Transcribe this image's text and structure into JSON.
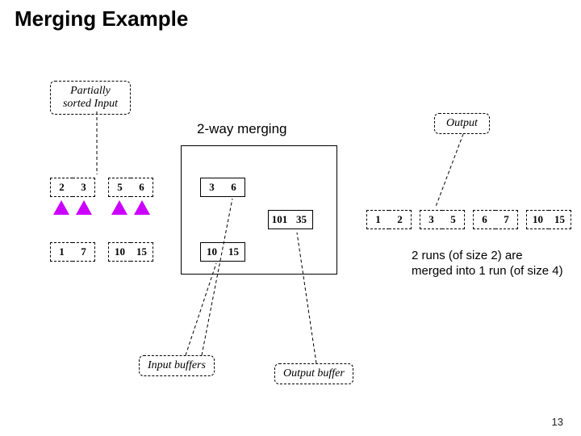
{
  "title": "Merging Example",
  "callouts": {
    "input": "Partially\nsorted Input",
    "output": "Output",
    "input_buffers": "Input buffers",
    "output_buffer": "Output buffer"
  },
  "merge_label": "2-way merging",
  "rows": {
    "top_left": [
      "2",
      "3",
      "5",
      "6"
    ],
    "bot_left": [
      "1",
      "7",
      "10",
      "15"
    ],
    "mid_buf_top": [
      "3",
      "6"
    ],
    "mid_buf_bot": [
      "10",
      "15"
    ],
    "out_buf": [
      "101",
      "35"
    ],
    "output": [
      "1",
      "2",
      "3",
      "5",
      "6",
      "7",
      "10",
      "15"
    ]
  },
  "note": "2 runs (of size 2) are merged into 1 run (of size 4)",
  "page": "13"
}
